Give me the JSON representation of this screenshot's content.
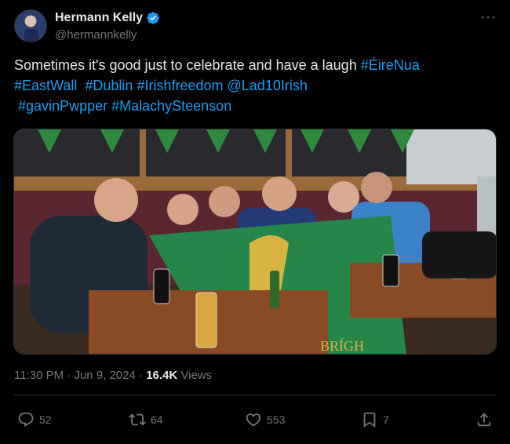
{
  "author": {
    "display_name": "Hermann Kelly",
    "handle": "@hermannkelly",
    "verified": true
  },
  "tweet": {
    "segments": [
      {
        "text": "Sometimes it's good just to celebrate and have a laugh ",
        "type": "text"
      },
      {
        "text": "#ÉireNua",
        "type": "tag"
      },
      {
        "text": "#EastWall",
        "type": "tag"
      },
      {
        "text": "#Dublin",
        "type": "tag"
      },
      {
        "text": "#Irishfreedom",
        "type": "tag"
      },
      {
        "text": "@Lad10Irish",
        "type": "tag"
      },
      {
        "text": "#gavinPwpper",
        "type": "tag"
      },
      {
        "text": "#MalachySteenson",
        "type": "tag"
      }
    ]
  },
  "media": {
    "flag_text": "BRÍGH"
  },
  "meta": {
    "time": "11:30 PM",
    "separator": "·",
    "date": "Jun 9, 2024",
    "views_count": "16.4K",
    "views_label": "Views"
  },
  "actions": {
    "replies": "52",
    "reposts": "64",
    "likes": "553",
    "bookmarks": "7"
  },
  "colors": {
    "accent": "#1d9bf0",
    "background": "#000000",
    "muted": "#71767b",
    "text": "#e7e9ea"
  }
}
